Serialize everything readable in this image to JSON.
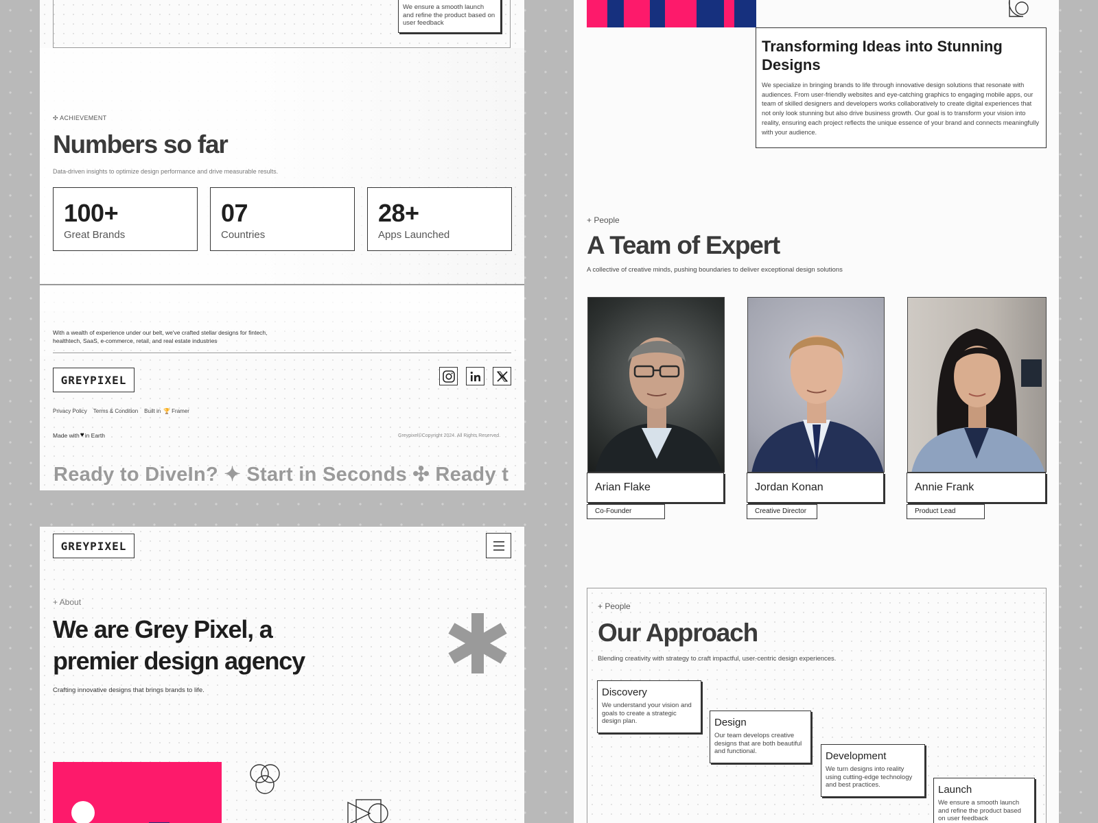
{
  "top_left": {
    "step_snippet": "We ensure a smooth launch and refine the product based on user feedback",
    "achievement": {
      "eyebrow": "✣ ACHIEVEMENT",
      "title": "Numbers so far",
      "subtitle": "Data-driven insights to optimize design performance and drive measurable results.",
      "stats": [
        {
          "value": "100+",
          "label": "Great Brands"
        },
        {
          "value": "07",
          "label": "Countries"
        },
        {
          "value": "28+",
          "label": "Apps Launched"
        }
      ]
    },
    "footer": {
      "description": "With a wealth of experience under our belt, we've crafted stellar designs for fintech, healthtech, SaaS, e-commerce, retail, and real estate industries",
      "logo": "GREYPIXEL",
      "links": [
        "Privacy Policy",
        "Terms & Condition",
        "Built in"
      ],
      "built_in_tool": "Framer",
      "made_with_prefix": "Made with",
      "made_with_suffix": "in Earth",
      "copyright": "Greypixel©Copyright 2024. All Rights Reserved.",
      "marquee": "Ready to DiveIn? ✦ Start in Seconds ✣ Ready t",
      "social_icons": [
        "instagram-icon",
        "linkedin-icon",
        "x-icon"
      ]
    }
  },
  "bottom_left": {
    "logo": "GREYPIXEL",
    "eyebrow": "+ About",
    "title_line1": "We are Grey Pixel, a",
    "title_line2": "premier design agency",
    "subtitle": "Crafting innovative designs that brings brands to life."
  },
  "top_right": {
    "title_line1": "Transforming Ideas into Stunning",
    "title_line2": "Designs",
    "body": "We specialize in bringing brands to life through innovative design solutions that resonate with audiences. From user-friendly websites and eye-catching graphics to engaging mobile apps, our team of skilled designers and developers works collaboratively to create digital experiences that not only look stunning but also drive business growth. Our goal is to transform your vision into reality, ensuring each project reflects the unique essence of your brand and connects meaningfully with your audience."
  },
  "team": {
    "eyebrow": "+ People",
    "title": "A Team of Expert",
    "subtitle": "A collective of creative minds, pushing boundaries to deliver exceptional design solutions",
    "members": [
      {
        "name": "Arian Flake",
        "role": "Co-Founder"
      },
      {
        "name": "Jordan Konan",
        "role": "Creative Director"
      },
      {
        "name": "Annie Frank",
        "role": "Product Lead"
      }
    ]
  },
  "approach": {
    "eyebrow": "+ People",
    "title": "Our Approach",
    "subtitle": "Blending creativity with strategy to craft impactful, user-centric design experiences.",
    "steps": [
      {
        "title": "Discovery",
        "desc": "We understand your vision and goals to create a strategic design plan."
      },
      {
        "title": "Design",
        "desc": "Our team develops creative designs that are both beautiful and functional."
      },
      {
        "title": "Development",
        "desc": "We turn designs into reality using cutting-edge technology and best practices."
      },
      {
        "title": "Launch",
        "desc": "We ensure a smooth launch and refine the product based on user feedback"
      }
    ]
  },
  "colors": {
    "pink": "#fd1a6b",
    "navy": "#16307e",
    "ink": "#2b2b2b",
    "grey_asterisk": "#9a9a9a"
  }
}
